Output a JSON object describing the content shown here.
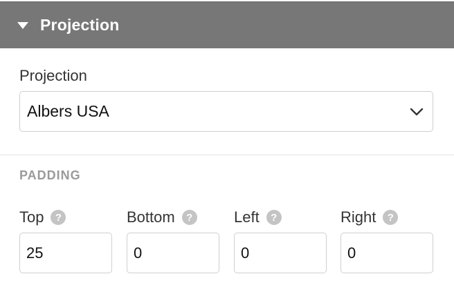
{
  "header": {
    "title": "Projection"
  },
  "projection": {
    "label": "Projection",
    "selected": "Albers USA"
  },
  "padding": {
    "section_title": "PADDING",
    "help_glyph": "?",
    "fields": [
      {
        "label": "Top",
        "value": "25"
      },
      {
        "label": "Bottom",
        "value": "0"
      },
      {
        "label": "Left",
        "value": "0"
      },
      {
        "label": "Right",
        "value": "0"
      }
    ]
  },
  "icons": {
    "collapse": "caret-down-icon",
    "select": "chevron-down-icon",
    "help": "help-icon"
  },
  "colors": {
    "header_bg": "#777777",
    "section_title": "#9a9a9a",
    "help_icon_bg": "#c4c4c4"
  }
}
